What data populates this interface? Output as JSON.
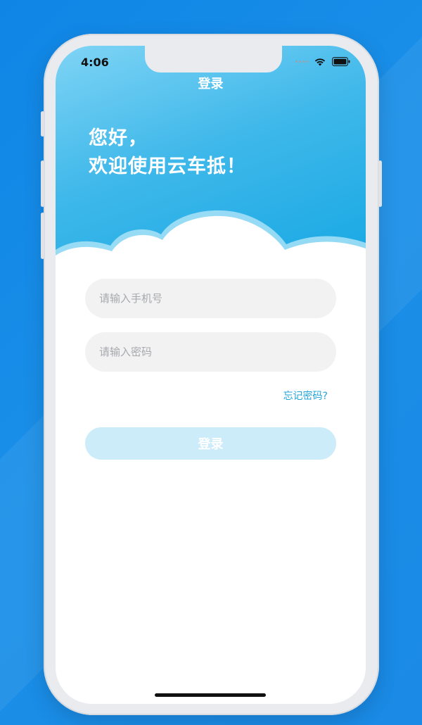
{
  "status_bar": {
    "time": "4:06"
  },
  "nav": {
    "title": "登录"
  },
  "hero": {
    "greeting_line1": "您好，",
    "greeting_line2": "欢迎使用云车抵！"
  },
  "form": {
    "phone_placeholder": "请输入手机号",
    "password_placeholder": "请输入密码",
    "forgot_label": "忘记密码?",
    "login_label": "登录"
  },
  "colors": {
    "background": "#1a8ae6",
    "hero_gradient_start": "#7fd4f5",
    "hero_gradient_end": "#15a7e3",
    "accent_link": "#22a4da",
    "login_button": "#ccecf9"
  },
  "icons": [
    "signal-dots-icon",
    "wifi-icon",
    "battery-icon"
  ]
}
